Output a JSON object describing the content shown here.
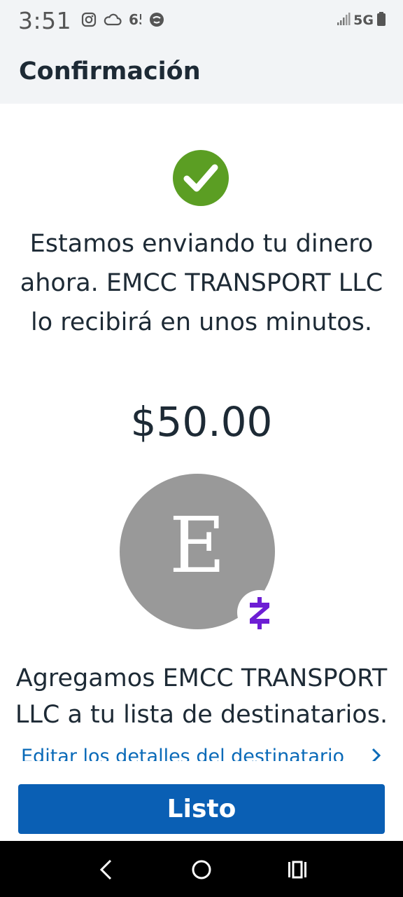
{
  "status_bar": {
    "time": "3:51",
    "network": "5G",
    "left_icons": [
      "instagram-icon",
      "cloud-icon",
      "quote-icon",
      "vpn-icon"
    ],
    "right_icons": [
      "signal-icon",
      "battery-icon"
    ]
  },
  "header": {
    "title": "Confirmación"
  },
  "confirmation": {
    "icon": "check-circle-icon",
    "icon_color": "#5b9e23",
    "message": "Estamos enviando tu dinero ahora. EMCC TRANSPORT LLC lo recibirá en unos minutos.",
    "amount": "$50.00"
  },
  "recipient": {
    "avatar_letter": "E",
    "avatar_color": "#999999",
    "badge_icon": "zelle-icon",
    "badge_color": "#6d1ed4",
    "added_message": "Agregamos EMCC TRANSPORT LLC a tu lista de destinatarios.",
    "edit_link": "Editar los detalles del destinatario"
  },
  "actions": {
    "done_label": "Listo",
    "accent": "#0a5fb4"
  },
  "nav_bar": {
    "buttons": [
      "back-icon",
      "home-icon",
      "recents-icon"
    ]
  }
}
